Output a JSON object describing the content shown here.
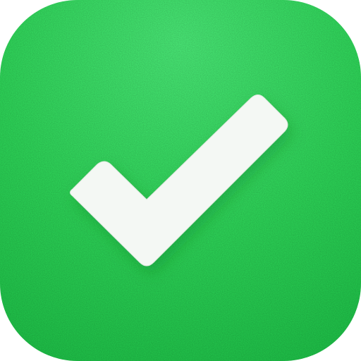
{
  "icon": {
    "name": "checkmark-icon",
    "colors": {
      "tile_top": "#4cf07a",
      "tile_mid": "#2fdc5b",
      "tile_bottom": "#1fc74a",
      "check": "#f4f8f4",
      "check_edge": "#dfe8df"
    }
  }
}
